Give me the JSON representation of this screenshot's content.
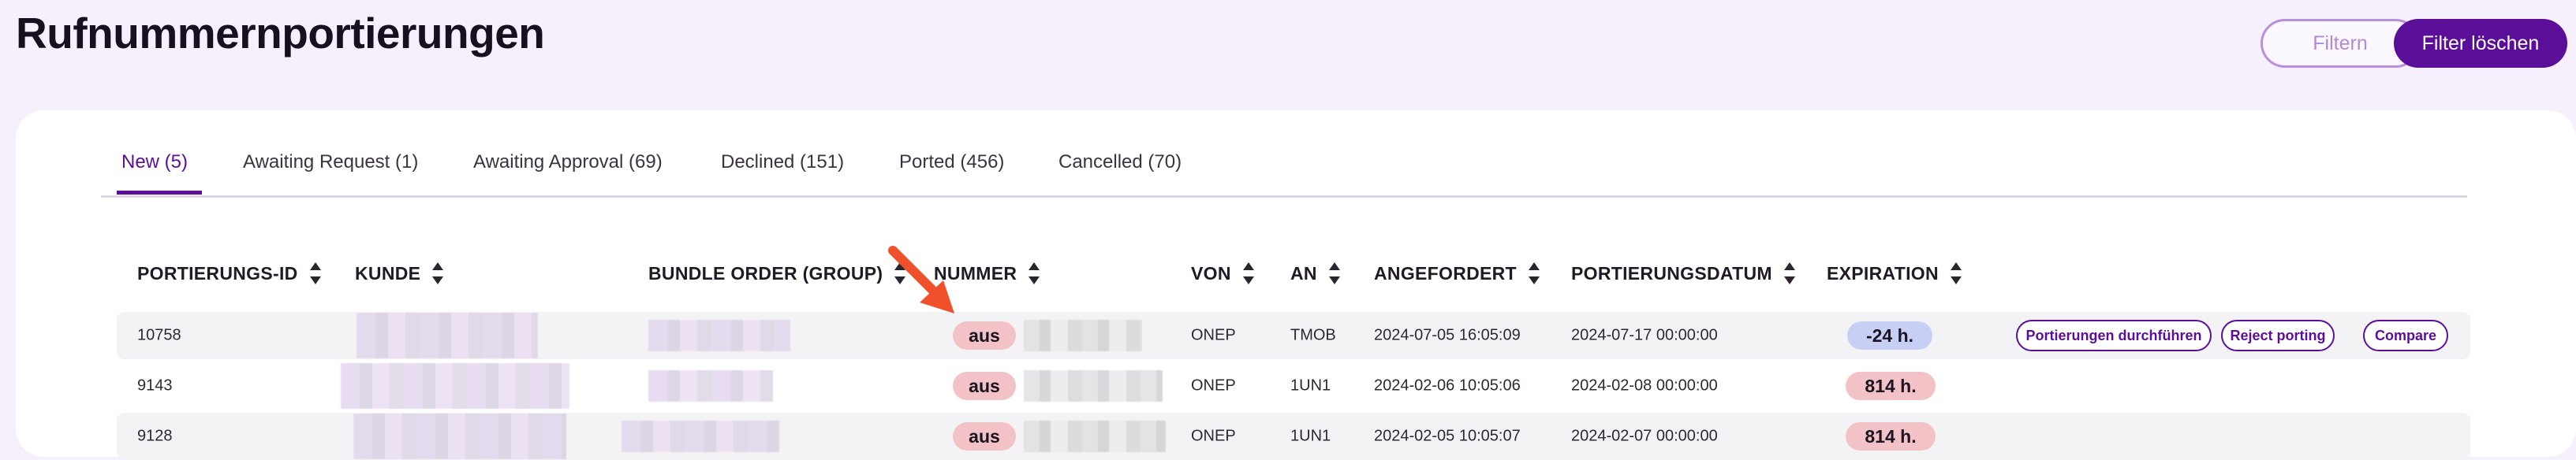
{
  "header": {
    "title": "Rufnummernportierungen",
    "filter_label": "Filtern",
    "clear_filter_label": "Filter löschen"
  },
  "tabs": [
    {
      "label": "New (5)",
      "active": true
    },
    {
      "label": "Awaiting Request (1)",
      "active": false
    },
    {
      "label": "Awaiting Approval (69)",
      "active": false
    },
    {
      "label": "Declined (151)",
      "active": false
    },
    {
      "label": "Ported (456)",
      "active": false
    },
    {
      "label": "Cancelled (70)",
      "active": false
    }
  ],
  "table": {
    "columns": [
      "PORTIERUNGS-ID",
      "KUNDE",
      "BUNDLE ORDER (GROUP)",
      "NUMMER",
      "VON",
      "AN",
      "ANGEFORDERT",
      "PORTIERUNGSDATUM",
      "EXPIRATION"
    ],
    "rows": [
      {
        "id": "10758",
        "number_status": "aus",
        "von": "ONEP",
        "an": "TMOB",
        "angefordert": "2024-07-05 16:05:09",
        "portierungsdatum": "2024-07-17 00:00:00",
        "expiration": "-24 h."
      },
      {
        "id": "9143",
        "number_status": "aus",
        "von": "ONEP",
        "an": "1UN1",
        "angefordert": "2024-02-06 10:05:06",
        "portierungsdatum": "2024-02-08 00:00:00",
        "expiration": "814 h."
      },
      {
        "id": "9128",
        "number_status": "aus",
        "von": "ONEP",
        "an": "1UN1",
        "angefordert": "2024-02-05 10:05:07",
        "portierungsdatum": "2024-02-07 00:00:00",
        "expiration": "814 h."
      }
    ],
    "actions": {
      "execute_label": "Portierungen durchführen",
      "reject_label": "Reject porting",
      "compare_label": "Compare"
    }
  },
  "colors": {
    "accent": "#5b0f99",
    "background": "#f6f0fc",
    "expiration_negative": "#c8cff5",
    "expiration_positive": "#f3c2c6",
    "annotation_arrow": "#f0502a"
  }
}
